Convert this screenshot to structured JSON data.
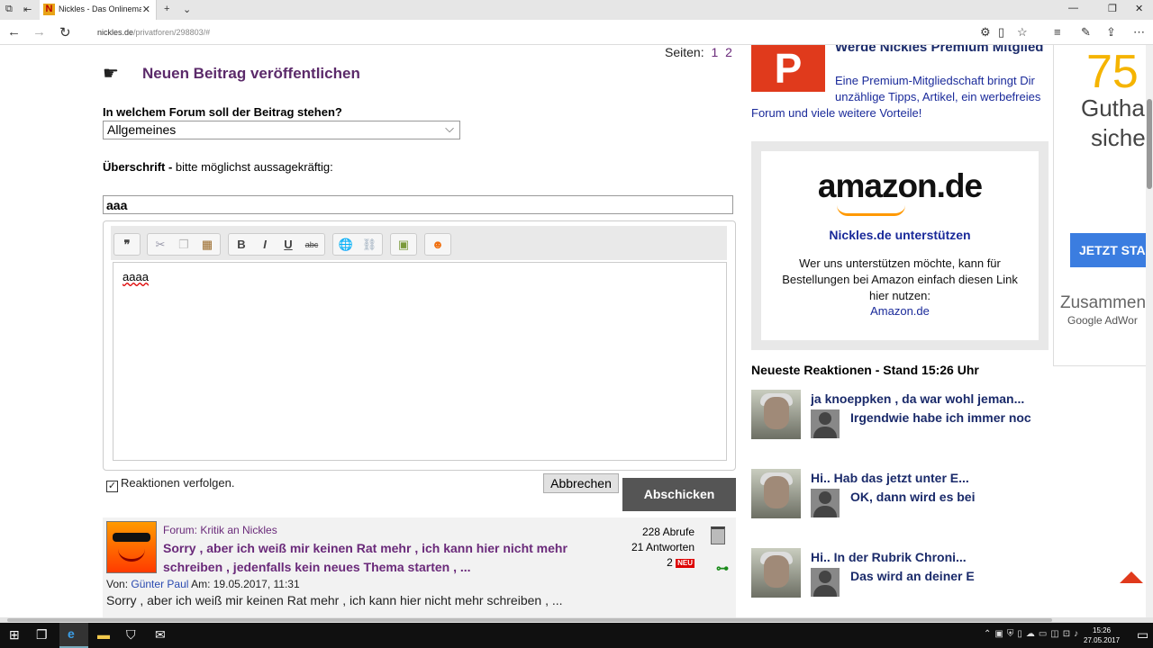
{
  "browser": {
    "tab_title": "Nickles - Das Onlinemagazin",
    "url_domain": "nickles.de",
    "url_path": "/privatforen/298803/#",
    "tab_favicon": "N"
  },
  "pagination": {
    "label": "Seiten:",
    "pages": [
      "1",
      "2"
    ]
  },
  "form": {
    "heading": "Neuen Beitrag veröffentlichen",
    "forum_question": "In welchem Forum soll der Beitrag stehen?",
    "forum_selected": "Allgemeines",
    "subject_label_bold": "Überschrift -",
    "subject_label_rest": " bitte möglichst aussagekräftig:",
    "subject_value": "aaa",
    "body_value": "aaaa",
    "follow_label": "Reaktionen verfolgen.",
    "cancel_label": "Abbrechen",
    "submit_label": "Abschicken"
  },
  "toolbar": {
    "quote": "❞",
    "bold": "B",
    "italic": "I",
    "underline": "U",
    "strike": "abc"
  },
  "post": {
    "forum": "Forum: Kritik an Nickles",
    "title": "Sorry , aber ich weiß mir keinen Rat mehr , ich kann hier nicht mehr schreiben , jedenfalls kein neues Thema starten , ...",
    "views": "228 Abrufe",
    "answers": "21 Antworten",
    "new_count": "2",
    "new_badge": "NEU",
    "by_label": "Von:",
    "author": "Günter Paul",
    "date_label": "Am: 19.05.2017, 11:31",
    "excerpt": "Sorry , aber ich weiß mir keinen Rat mehr , ich kann hier nicht mehr schreiben , ..."
  },
  "sidebar": {
    "premium_logo": "P",
    "premium_title": "Werde Nickles Premium Mitglied",
    "premium_desc": "Eine Premium-Mitgliedschaft bringt Dir unzählige Tipps, Artikel, ein werbefreies",
    "premium_desc2": "Forum und viele weitere Vorteile!",
    "amazon_logo": "amazon.de",
    "amazon_heading": "Nickles.de unterstützen",
    "amazon_text": "Wer uns unterstützen möchte, kann für Bestellungen bei Amazon einfach diesen Link hier nutzen:",
    "amazon_link": "Amazon.de",
    "reactions_heading": "Neueste Reaktionen - Stand 15:26 Uhr",
    "reactions": [
      {
        "line1": "ja knoeppken , da war wohl jeman...",
        "line2": "Irgendwie habe ich immer noc"
      },
      {
        "line1": "Hi.. Hab das jetzt unter E...",
        "line2": "OK, dann wird es bei"
      },
      {
        "line1": "Hi.. In der Rubrik Chroni...",
        "line2": "Das wird an deiner E"
      }
    ]
  },
  "ad": {
    "number": "75",
    "line1": "Guthab",
    "line2": "sicher",
    "button": "JETZT STA",
    "line3": "Zusammen",
    "line4": "Google AdWor"
  },
  "taskbar": {
    "time": "15:26",
    "date": "27.05.2017"
  }
}
